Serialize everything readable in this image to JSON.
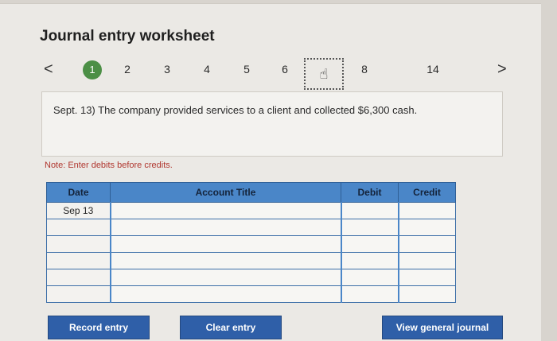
{
  "page": {
    "title": "Journal entry worksheet"
  },
  "nav": {
    "prev_icon": "chevron-left-icon",
    "next_icon": "chevron-right-icon",
    "prev_glyph": "<",
    "next_glyph": ">",
    "steps": [
      "1",
      "2",
      "3",
      "4",
      "5",
      "6",
      "",
      "8",
      "14"
    ],
    "active_step": "1",
    "cursor_glyph": "☝"
  },
  "prompt": {
    "text": "Sept. 13) The company provided services to a client and collected $6,300 cash."
  },
  "note": "Note: Enter debits before credits.",
  "journal": {
    "headers": [
      "Date",
      "Account Title",
      "Debit",
      "Credit"
    ],
    "rows": [
      {
        "date": "Sep 13",
        "account": "",
        "debit": "",
        "credit": ""
      },
      {
        "date": "",
        "account": "",
        "debit": "",
        "credit": ""
      },
      {
        "date": "",
        "account": "",
        "debit": "",
        "credit": ""
      },
      {
        "date": "",
        "account": "",
        "debit": "",
        "credit": ""
      },
      {
        "date": "",
        "account": "",
        "debit": "",
        "credit": ""
      },
      {
        "date": "",
        "account": "",
        "debit": "",
        "credit": ""
      }
    ]
  },
  "buttons": {
    "record": "Record entry",
    "clear": "Clear entry",
    "view": "View general journal"
  },
  "colors": {
    "active_step": "#4c8f46",
    "header": "#4a86c8",
    "button": "#2f5fa8",
    "note": "#b0362e"
  }
}
